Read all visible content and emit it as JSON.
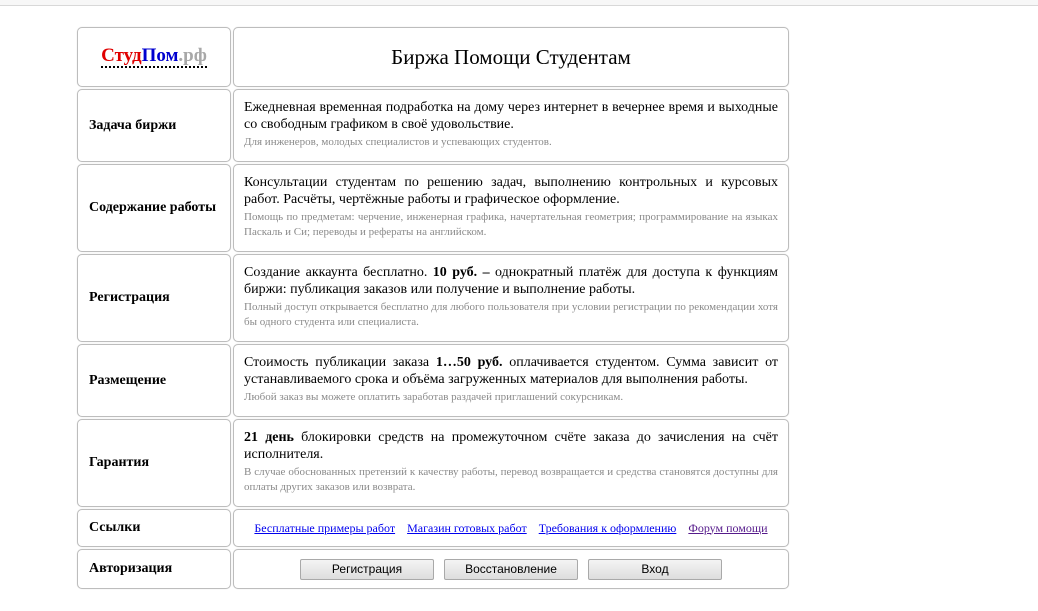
{
  "header": {
    "logo_part1": "Студ",
    "logo_part2": "Пом",
    "logo_part3": ".рф",
    "title": "Биржа Помощи Студентам"
  },
  "rows": [
    {
      "label": "Задача биржи",
      "main": "Ежедневная временная подработка на дому через интернет в вечернее время и выходные со свободным графиком в своё удовольствие.",
      "sub": "Для инженеров, молодых специалистов и успевающих студентов."
    },
    {
      "label": "Содержание работы",
      "main": "Консультации студентам по решению задач, выполнению контрольных и курсовых работ. Расчёты, чертёжные работы и графическое оформление.",
      "sub": "Помощь по предметам: черчение, инженерная графика, начертательная геометрия; программирование на языках Паскаль и Си; переводы и рефераты на английском."
    },
    {
      "label": "Регистрация",
      "main_pre": "Создание аккаунта бесплатно. ",
      "main_bold": "10 руб. –",
      "main_post": " однократный платёж для доступа к функциям биржи: публикация заказов или получение и выполнение работы.",
      "sub": "Полный доступ открывается бесплатно для любого пользователя при условии регистрации по рекомендации хотя бы одного студента или специалиста."
    },
    {
      "label": "Размещение",
      "main_pre": "Стоимость публикации заказа ",
      "main_bold": "1…50 руб.",
      "main_post": " оплачивается студентом. Сумма зависит от устанавливаемого срока и объёма загруженных материалов для выполнения работы.",
      "sub": "Любой заказ вы можете оплатить заработав раздачей приглашений сокурсникам."
    },
    {
      "label": "Гарантия",
      "main_pre": "",
      "main_bold": "21 день",
      "main_post": " блокировки средств на промежуточном счёте заказа до зачисления на счёт исполнителя.",
      "sub": "В случае обоснованных претензий к качеству работы, перевод возвращается и средства становятся доступны для оплаты других заказов или возврата."
    }
  ],
  "links_row": {
    "label": "Ссылки",
    "links": [
      "Бесплатные примеры работ",
      "Магазин готовых работ",
      "Требования к оформлению",
      "Форум помощи"
    ]
  },
  "auth_row": {
    "label": "Авторизация",
    "buttons": [
      "Регистрация",
      "Восстановление",
      "Вход"
    ]
  },
  "colors": {
    "logo_red": "#e00000",
    "logo_blue": "#0000d0",
    "logo_gray": "#a8a8a8",
    "link": "#0000ee",
    "visited_link": "#551a8b"
  }
}
